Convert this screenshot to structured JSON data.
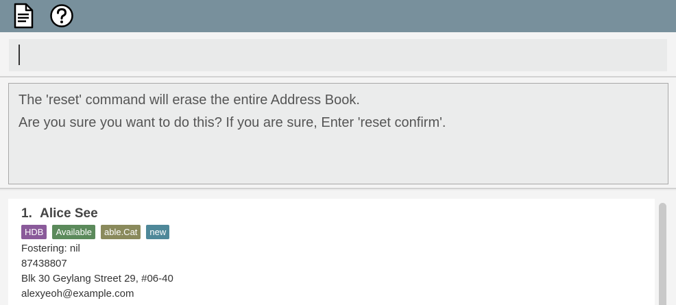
{
  "toolbar": {
    "icons": [
      "file-icon",
      "help-icon"
    ],
    "background": "#78909c"
  },
  "command_box": {
    "value": "",
    "placeholder": ""
  },
  "result_display": {
    "lines": [
      "The 'reset' command will erase the entire Address Book.",
      "Are you sure you want to do this? If you are sure, Enter 'reset confirm'."
    ]
  },
  "person_list": {
    "cards": [
      {
        "index": "1.",
        "name": "Alice See",
        "tags": [
          {
            "label": "HDB",
            "color": "#8a5a9a"
          },
          {
            "label": "Available",
            "color": "#5b8a5b"
          },
          {
            "label": "able.Cat",
            "color": "#8a8a5c"
          },
          {
            "label": "new",
            "color": "#4e8899"
          }
        ],
        "fostering": "Fostering: nil",
        "phone": "87438807",
        "address": "Blk 30 Geylang Street 29, #06-40",
        "email": "alexyeoh@example.com"
      }
    ]
  }
}
